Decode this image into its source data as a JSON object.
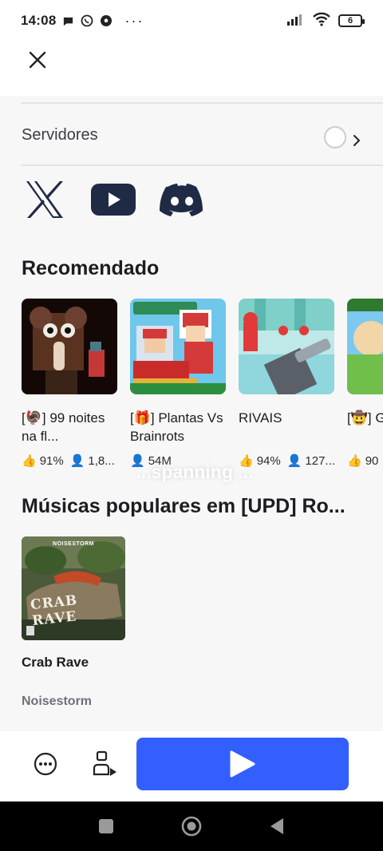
{
  "status_bar": {
    "time": "14:08",
    "battery": "6",
    "left_icons": [
      "chat-bubble-icon",
      "whatsapp-icon",
      "soccer-ball-icon"
    ],
    "more": "···"
  },
  "servers": {
    "label": "Servidores"
  },
  "social": [
    "x-logo-icon",
    "youtube-icon",
    "discord-icon"
  ],
  "recommended": {
    "title": "Recomendado",
    "games": [
      {
        "name": "[🦃] 99 noites na fl...",
        "rating": "91%",
        "players": "1,8..."
      },
      {
        "name": "[🎁] Plantas Vs Brainrots",
        "rating": "",
        "players": "54M"
      },
      {
        "name": "RIVAIS",
        "rating": "94%",
        "players": "127..."
      },
      {
        "name": "[🤠] G um Ja",
        "rating": "90",
        "players": ""
      }
    ]
  },
  "overlay_text": "...spanning ...",
  "music": {
    "title": "Músicas populares em [UPD] Ro...",
    "track": {
      "name": "Crab Rave",
      "artist": "Noisestorm",
      "cover_label": "NOISESTORM",
      "cover_title": "CRAB RAVE"
    }
  },
  "colors": {
    "accent": "#335fff",
    "background": "#f7f7f8",
    "text": "#1d1d20"
  }
}
